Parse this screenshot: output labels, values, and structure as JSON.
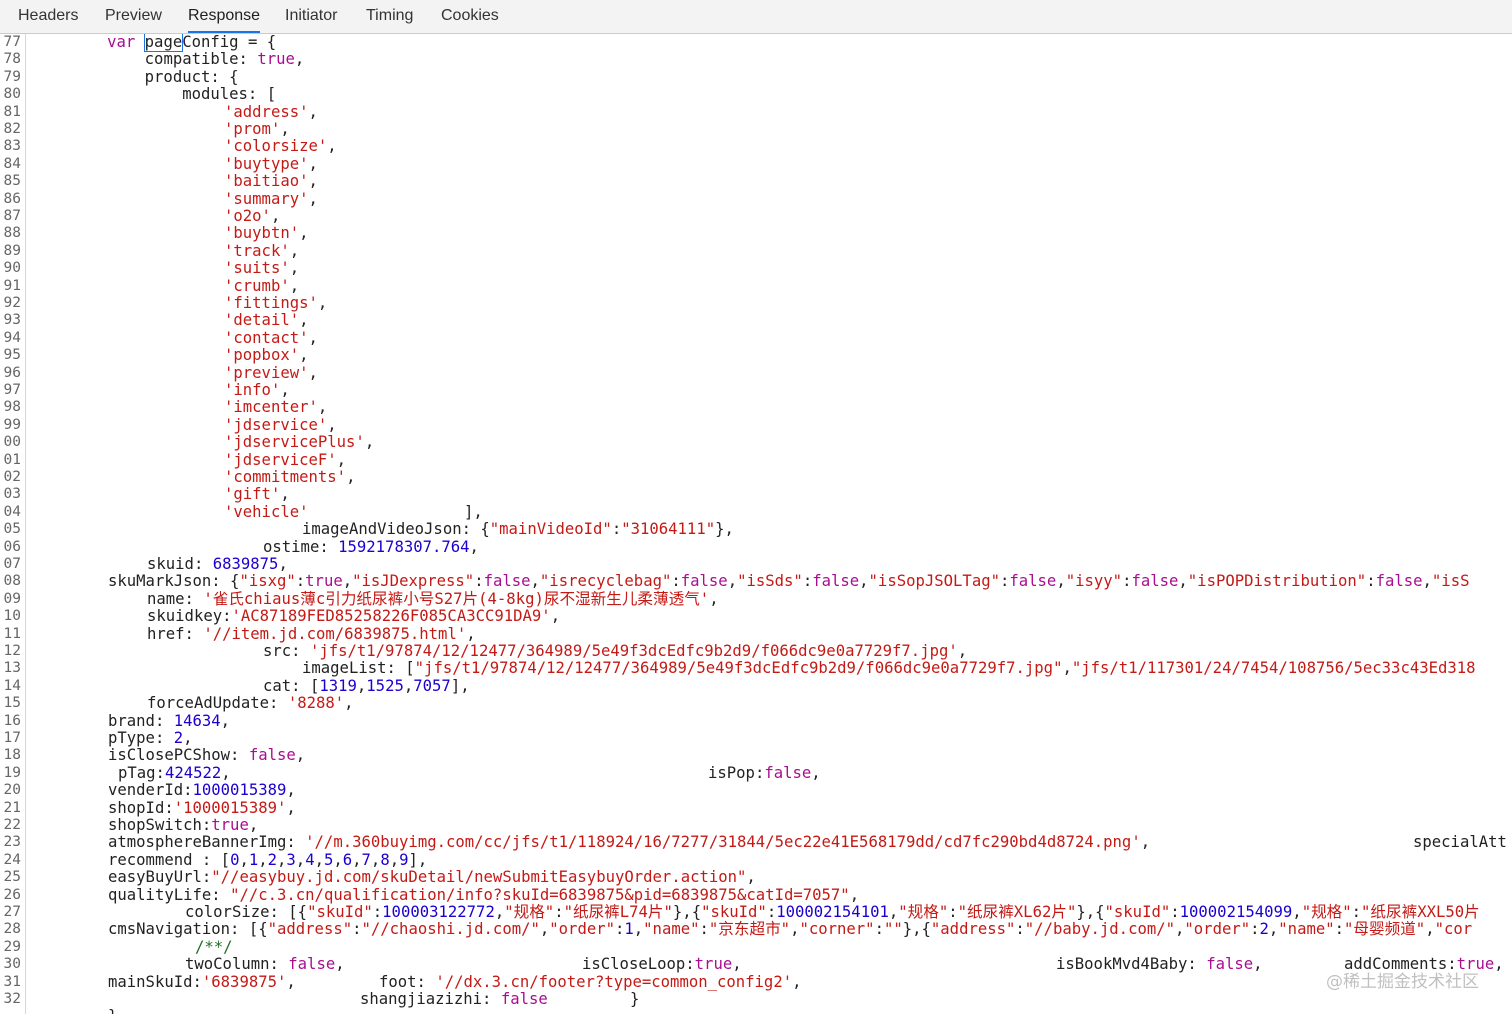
{
  "tabs": [
    {
      "label": "Headers",
      "active": false
    },
    {
      "label": "Preview",
      "active": false
    },
    {
      "label": "Response",
      "active": true
    },
    {
      "label": "Initiator",
      "active": false
    },
    {
      "label": "Timing",
      "active": false
    },
    {
      "label": "Cookies",
      "active": false
    }
  ],
  "line_numbers": [
    "77",
    "78",
    "79",
    "80",
    "81",
    "82",
    "83",
    "84",
    "85",
    "86",
    "87",
    "88",
    "89",
    "90",
    "91",
    "92",
    "93",
    "94",
    "95",
    "96",
    "97",
    "98",
    "99",
    "00",
    "01",
    "02",
    "03",
    "04",
    "05",
    "06",
    "07",
    "08",
    "09",
    "10",
    "11",
    "12",
    "13",
    "14",
    "15",
    "16",
    "17",
    "18",
    "19",
    "20",
    "21",
    "22",
    "23",
    "24",
    "25",
    "26",
    "27",
    "28",
    "29",
    "30",
    "31",
    "32"
  ],
  "code": {
    "l77": {
      "indent": "        ",
      "kw": "var",
      "name_a": "page",
      "name_b": "Config",
      "rest": " = {"
    },
    "l78": {
      "indent": "            ",
      "key": "compatible: ",
      "val": "true",
      ",": ","
    },
    "l79": {
      "text": "            product: {"
    },
    "l80": {
      "text": "                modules: ["
    },
    "modules": [
      "'address'",
      "'prom'",
      "'colorsize'",
      "'buytype'",
      "'baitiao'",
      "'summary'",
      "'o2o'",
      "'buybtn'",
      "'track'",
      "'suits'",
      "'crumb'",
      "'fittings'",
      "'detail'",
      "'contact'",
      "'popbox'",
      "'preview'",
      "'info'",
      "'imcenter'",
      "'jdservice'",
      "'jdservicePlus'",
      "'jdserviceF'",
      "'commitments'",
      "'gift'",
      "'vehicle'"
    ],
    "l104_close": "],",
    "l105": {
      "key": "imageAndVideoJson: {",
      "k1": "\"mainVideoId\"",
      "sep": ":",
      "v1": "\"31064111\"",
      "end": "},"
    },
    "l106": {
      "key": "ostime: ",
      "val": "1592178307.764",
      "end": ","
    },
    "l107": {
      "key": "skuid: ",
      "val": "6839875",
      "end": ","
    },
    "l108": {
      "key": "skuMarkJson: {",
      "p1": "\"isxg\"",
      "v1": "true",
      "p2": "\"isJDexpress\"",
      "v2": "false",
      "p3": "\"isrecyclebag\"",
      "v3": "false",
      "p4": "\"isSds\"",
      "v4": "false",
      "p5": "\"isSopJSOLTag\"",
      "v5": "false",
      "p6": "\"isyy\"",
      "v6": "false",
      "p7": "\"isPOPDistribution\"",
      "v7": "false",
      "p8": "\"isS"
    },
    "l109": {
      "key": "name: ",
      "val": "'雀氏chiaus薄c引力纸尿裤小号S27片(4-8kg)尿不湿新生儿柔薄透气'",
      "end": ","
    },
    "l110": {
      "key": "skuidkey:",
      "val": "'AC87189FED85258226F085CA3CC91DA9'",
      "end": ","
    },
    "l111": {
      "key": "href: ",
      "val": "'//item.jd.com/6839875.html'",
      "end": ","
    },
    "l112": {
      "key": "src: ",
      "val": "'jfs/t1/97874/12/12477/364989/5e49f3dcEdfc9b2d9/f066dc9e0a7729f7.jpg'",
      "end": ","
    },
    "l113": {
      "key": "imageList: [",
      "v1": "\"jfs/t1/97874/12/12477/364989/5e49f3dcEdfc9b2d9/f066dc9e0a7729f7.jpg\"",
      "sep": ",",
      "v2": "\"jfs/t1/117301/24/7454/108756/5ec33c43Ed318"
    },
    "l114": {
      "key": "cat: [",
      "n1": "1319",
      "n2": "1525",
      "n3": "7057",
      "end": "],"
    },
    "l115": {
      "key": "forceAdUpdate: ",
      "val": "'8288'",
      "end": ","
    },
    "l116": {
      "key": "brand: ",
      "val": "14634",
      "end": ","
    },
    "l117": {
      "key": "pType: ",
      "val": "2",
      "end": ","
    },
    "l118": {
      "key": "isClosePCShow: ",
      "val": "false",
      "end": ","
    },
    "l119": {
      "key": "pTag:",
      "val": "424522",
      "end": ",",
      "key2": "isPop:",
      "val2": "false",
      "end2": ","
    },
    "l120": {
      "key": "venderId:",
      "val": "1000015389",
      "end": ","
    },
    "l121": {
      "key": "shopId:",
      "val": "'1000015389'",
      "end": ","
    },
    "l122": {
      "key": "shopSwitch:",
      "val": "true",
      "end": ","
    },
    "l123": {
      "key": "atmosphereBannerImg: ",
      "val": "'//m.360buyimg.com/cc/jfs/t1/118924/16/7277/31844/5ec22e41E568179dd/cd7fc290bd4d8724.png'",
      "end": ",",
      "key2": "specialAtt"
    },
    "l124": {
      "key": "recommend : [",
      "nums": [
        "0",
        "1",
        "2",
        "3",
        "4",
        "5",
        "6",
        "7",
        "8",
        "9"
      ],
      "end": "],"
    },
    "l125": {
      "key": "easyBuyUrl:",
      "val": "\"//easybuy.jd.com/skuDetail/newSubmitEasybuyOrder.action\"",
      "end": ","
    },
    "l126": {
      "key": "qualityLife: ",
      "val": "\"//c.3.cn/qualification/info?skuId=6839875&pid=6839875&catId=7057\"",
      "end": ","
    },
    "l127": {
      "key": "colorSize: [{",
      "a1": "\"skuId\"",
      "b1": "100003122772",
      "a2": "\"规格\"",
      "b2": "\"纸尿裤L74片\"",
      "a3": "\"skuId\"",
      "b3": "100002154101",
      "a4": "\"规格\"",
      "b4": "\"纸尿裤XL62片\"",
      "a5": "\"skuId\"",
      "b5": "100002154099",
      "a6": "\"规格\"",
      "b6": "\"纸尿裤XXL50片"
    },
    "l128": {
      "key": "cmsNavigation: [{",
      "a1": "\"address\"",
      "b1": "\"//chaoshi.jd.com/\"",
      "a2": "\"order\"",
      "b2": "1",
      "a3": "\"name\"",
      "b3": "\"京东超市\"",
      "a4": "\"corner\"",
      "b4": "\"\"",
      "a5": "\"address\"",
      "b5": "\"//baby.jd.com/\"",
      "a6": "\"order\"",
      "b6": "2",
      "a7": "\"name\"",
      "b7": "\"母婴频道\"",
      "a8": "\"cor"
    },
    "l129": {
      "comment": "/**/"
    },
    "l130": {
      "k1": "twoColumn: ",
      "v1": "false",
      "k2": "isCloseLoop:",
      "v2": "true",
      "k3": "isBookMvd4Baby: ",
      "v3": "false",
      "k4": "addComments:",
      "v4": "true"
    },
    "l131": {
      "key": "mainSkuId:",
      "val": "'6839875'",
      "end": ",",
      "key2": "foot: ",
      "val2": "'//dx.3.cn/footer?type=common_config2'",
      "end2": ","
    },
    "l132": {
      "key": "shangjiazizhi: ",
      "val": "false",
      "end": "}"
    },
    "l133": {
      "text": "}"
    }
  },
  "watermark": "@稀土掘金技术社区"
}
